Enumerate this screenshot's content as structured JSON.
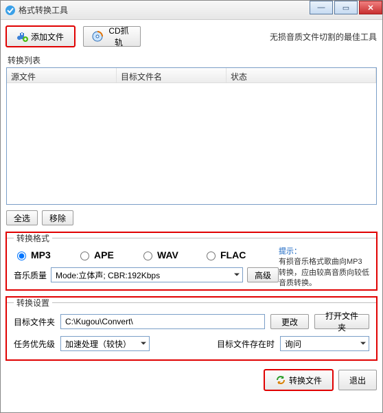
{
  "window": {
    "title": "格式转换工具"
  },
  "toolbar": {
    "add_file_label": "添加文件",
    "cd_rip_label": "CD抓轨",
    "tagline": "无损音质文件切割的最佳工具"
  },
  "list": {
    "section_label": "转换列表",
    "headers": {
      "source": "源文件",
      "target": "目标文件名",
      "status": "状态"
    }
  },
  "list_buttons": {
    "select_all": "全选",
    "remove": "移除"
  },
  "format": {
    "legend": "转换格式",
    "options": {
      "mp3": "MP3",
      "ape": "APE",
      "wav": "WAV",
      "flac": "FLAC"
    },
    "hint_title": "提示：",
    "hint_body": "有损音乐格式歌曲向MP3转换，应由较高音质向较低音质转换。",
    "quality_label": "音乐质量",
    "quality_value": "Mode:立体声; CBR:192Kbps",
    "advanced_label": "高级"
  },
  "settings": {
    "legend": "转换设置",
    "target_folder_label": "目标文件夹",
    "target_folder_value": "C:\\Kugou\\Convert\\",
    "change_label": "更改",
    "open_folder_label": "打开文件夹",
    "priority_label": "任务优先级",
    "priority_value": "加速处理（较快）",
    "on_exist_label": "目标文件存在时",
    "on_exist_value": "询问"
  },
  "bottom": {
    "convert_label": "转换文件",
    "exit_label": "退出"
  }
}
